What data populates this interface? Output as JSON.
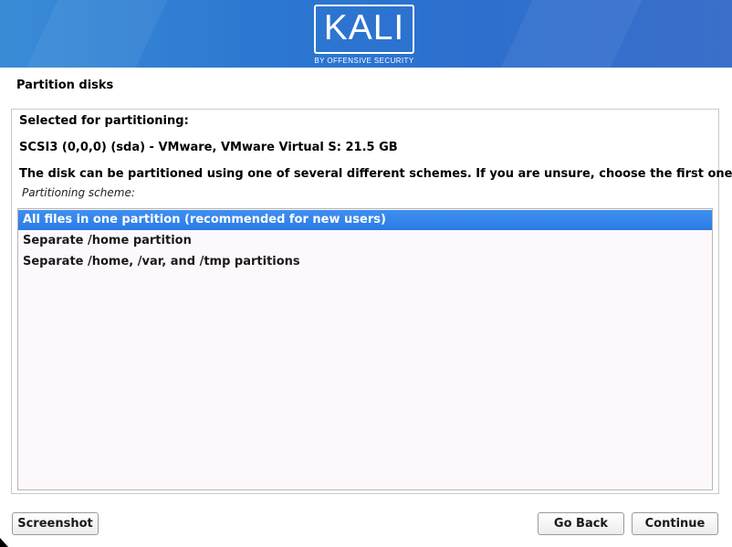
{
  "header": {
    "logo_text": "KALI",
    "logo_subtitle": "BY OFFENSIVE SECURITY",
    "colors": {
      "banner": "#2d78d2",
      "logo": "#ffffff"
    }
  },
  "page": {
    "title": "Partition disks"
  },
  "content": {
    "selected_heading": "Selected for partitioning:",
    "disk_name": "SCSI3 (0,0,0) (sda) - VMware, VMware Virtual S: 21.5 GB",
    "description": "The disk can be partitioned using one of several different schemes. If you are unsure, choose the first one.",
    "list_label": "Partitioning scheme:",
    "options": [
      {
        "label": "All files in one partition (recommended for new users)",
        "selected": true
      },
      {
        "label": "Separate /home partition",
        "selected": false
      },
      {
        "label": "Separate /home, /var, and /tmp partitions",
        "selected": false
      }
    ],
    "colors": {
      "selection": "#2f82ea",
      "list_background": "#fdf8fc"
    }
  },
  "buttons": {
    "screenshot": "Screenshot",
    "go_back": "Go Back",
    "continue": "Continue"
  }
}
